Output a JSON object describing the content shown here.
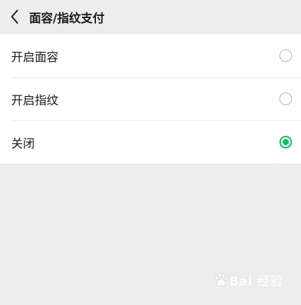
{
  "header": {
    "back_icon": "chevron-left-icon",
    "title": "面容/指纹支付"
  },
  "options": [
    {
      "label": "开启面容",
      "selected": false
    },
    {
      "label": "开启指纹",
      "selected": false
    },
    {
      "label": "关闭",
      "selected": true
    }
  ],
  "colors": {
    "accent": "#07c160",
    "background": "#ededed",
    "card": "#ffffff"
  },
  "watermark": {
    "logo": "baidu-paw-logo",
    "text": "Bai 经验"
  }
}
